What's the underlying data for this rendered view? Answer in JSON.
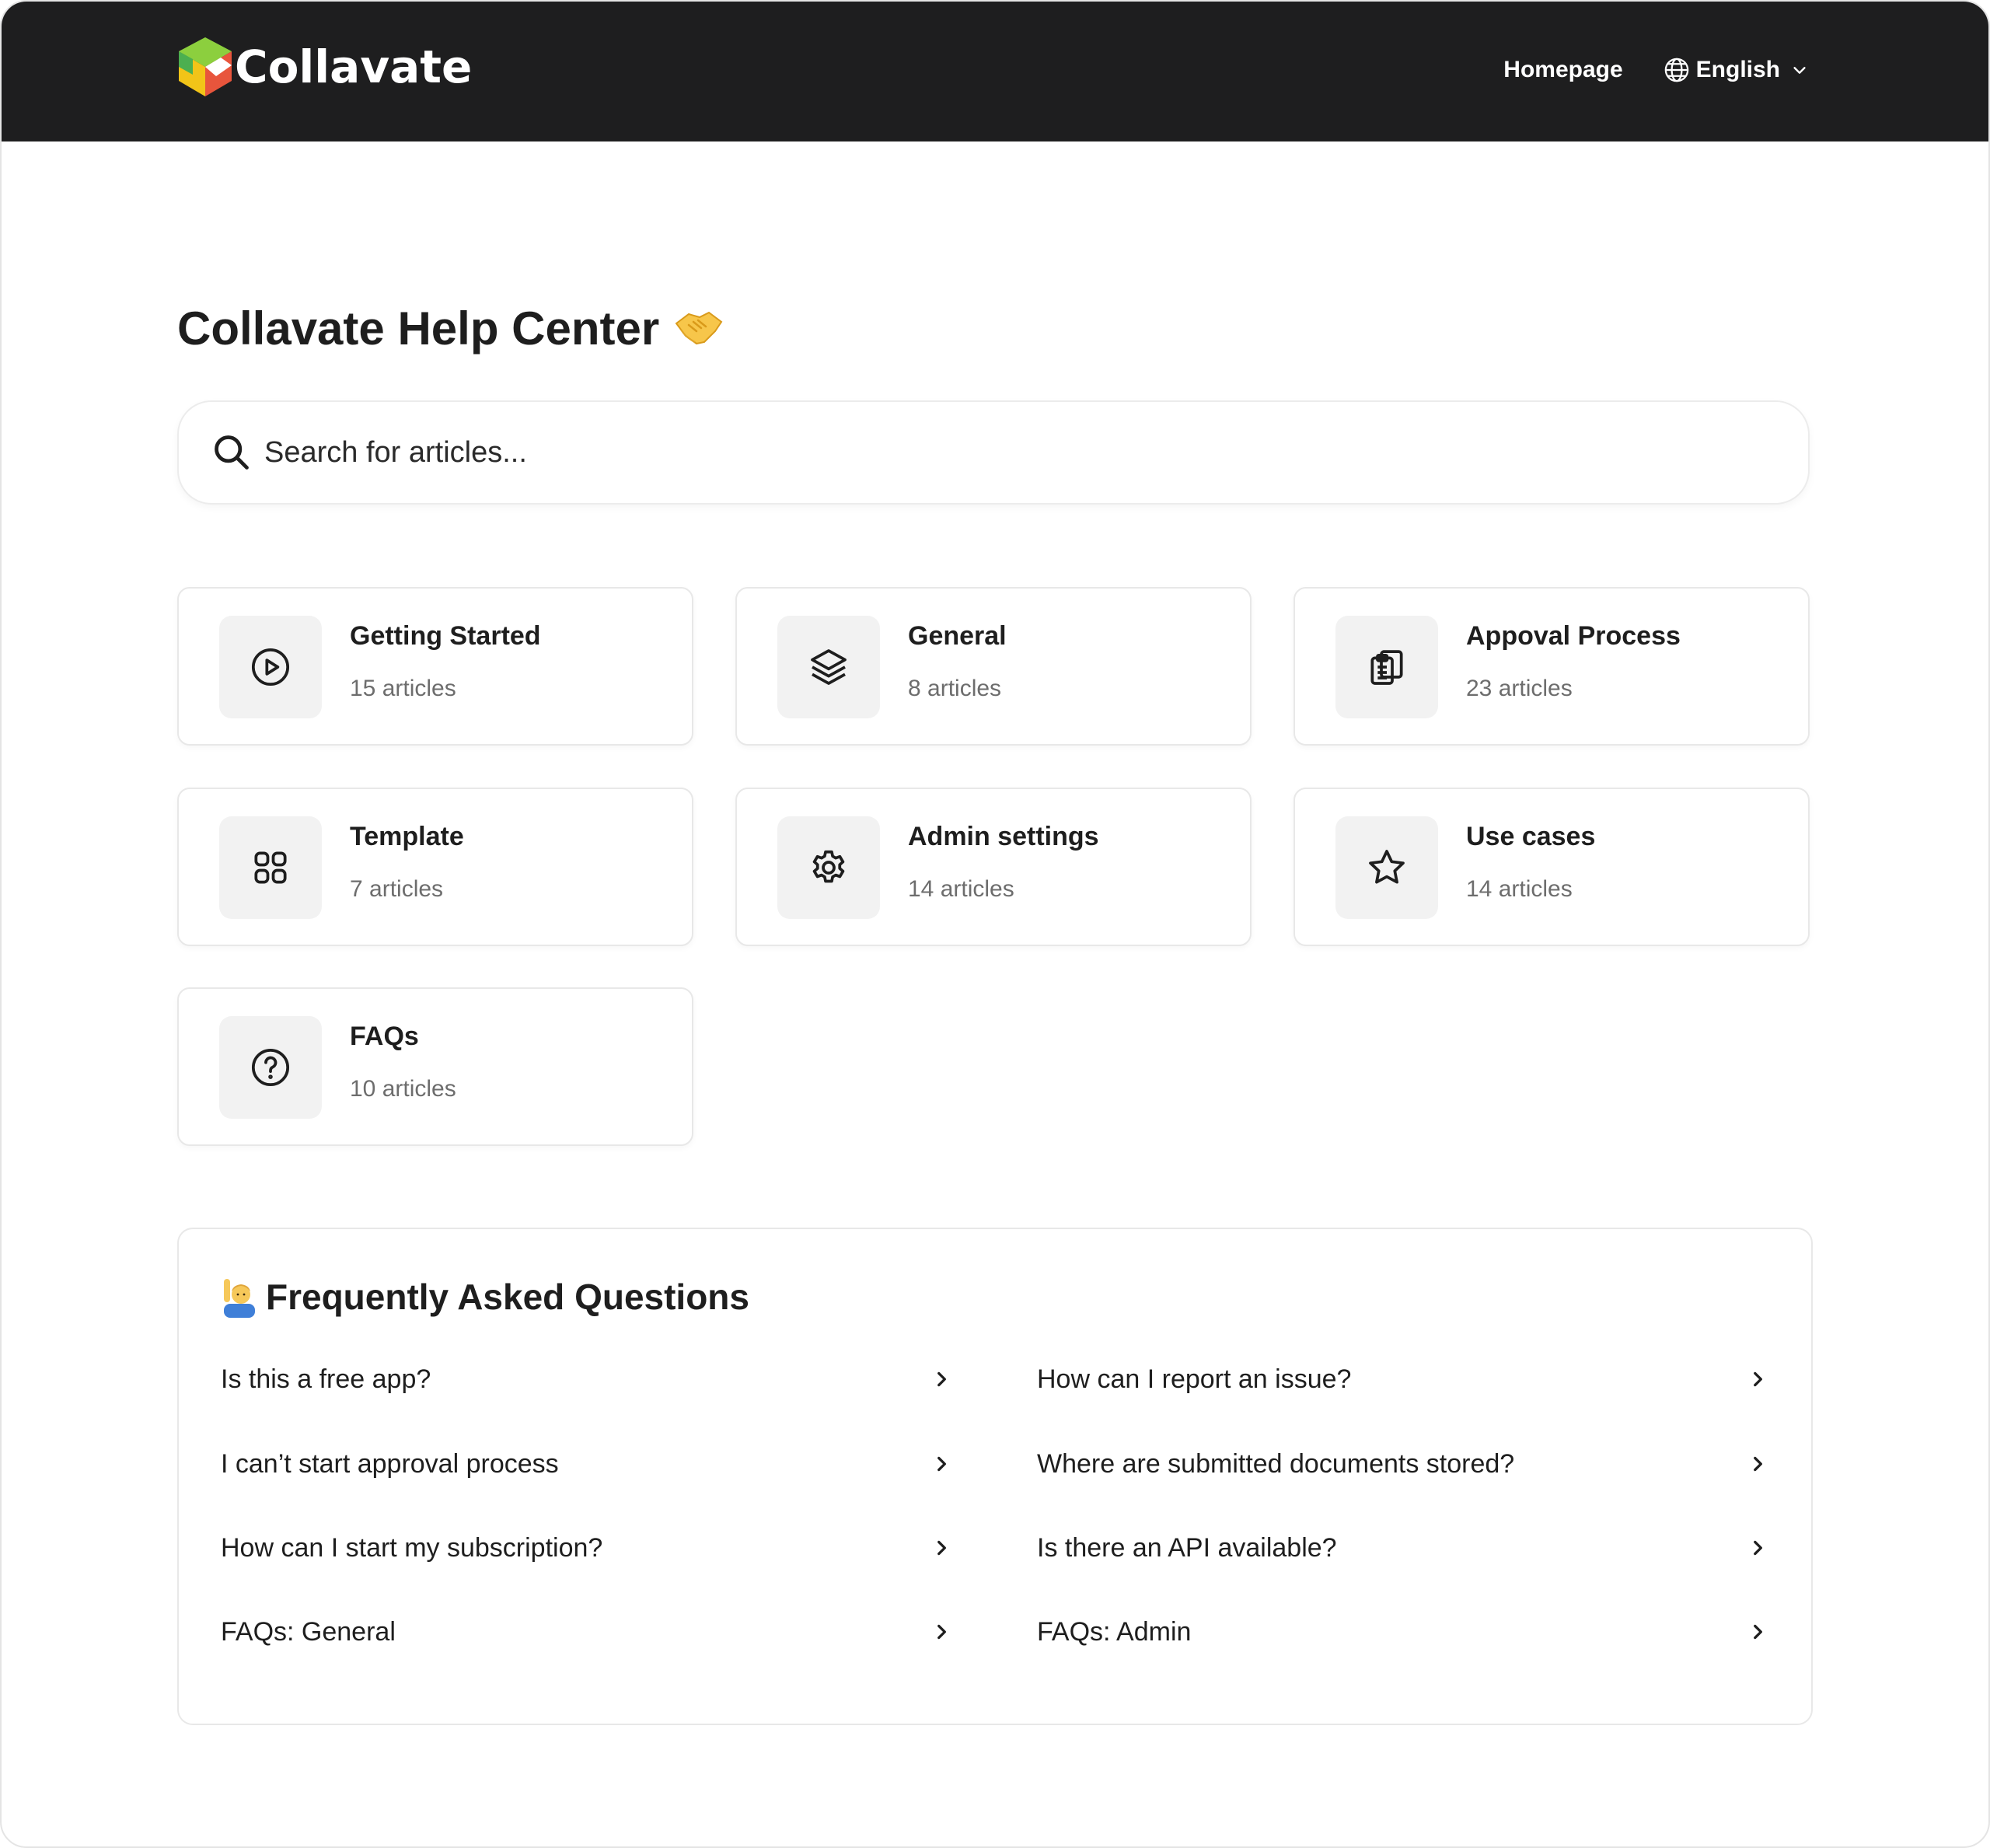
{
  "header": {
    "brand": "Collavate",
    "nav_homepage": "Homepage",
    "language": "English",
    "colors": {
      "background": "#1e1e1f",
      "text": "#ffffff"
    }
  },
  "page": {
    "title": "Collavate Help Center",
    "title_emoji": "handshake-emoji"
  },
  "search": {
    "placeholder": "Search for articles..."
  },
  "categories": [
    {
      "title": "Getting Started",
      "count": "15 articles",
      "icon": "play-circle-icon"
    },
    {
      "title": "General",
      "count": "8 articles",
      "icon": "layers-icon"
    },
    {
      "title": "Appoval Process",
      "count": "23 articles",
      "icon": "clipboard-copy-icon"
    },
    {
      "title": "Template",
      "count": "7 articles",
      "icon": "grid-icon"
    },
    {
      "title": "Admin settings",
      "count": "14 articles",
      "icon": "gear-icon"
    },
    {
      "title": "Use cases",
      "count": "14 articles",
      "icon": "star-icon"
    },
    {
      "title": "FAQs",
      "count": "10 articles",
      "icon": "question-circle-icon"
    }
  ],
  "faq": {
    "title": "Frequently Asked Questions",
    "title_emoji": "person-raising-hand-emoji",
    "left": [
      "Is this a free app?",
      "I can’t start approval process",
      "How can I start my subscription?",
      "FAQs: General"
    ],
    "right": [
      "How can I report an issue?",
      "Where are submitted documents stored?",
      "Is there an API available?",
      "FAQs: Admin"
    ]
  }
}
